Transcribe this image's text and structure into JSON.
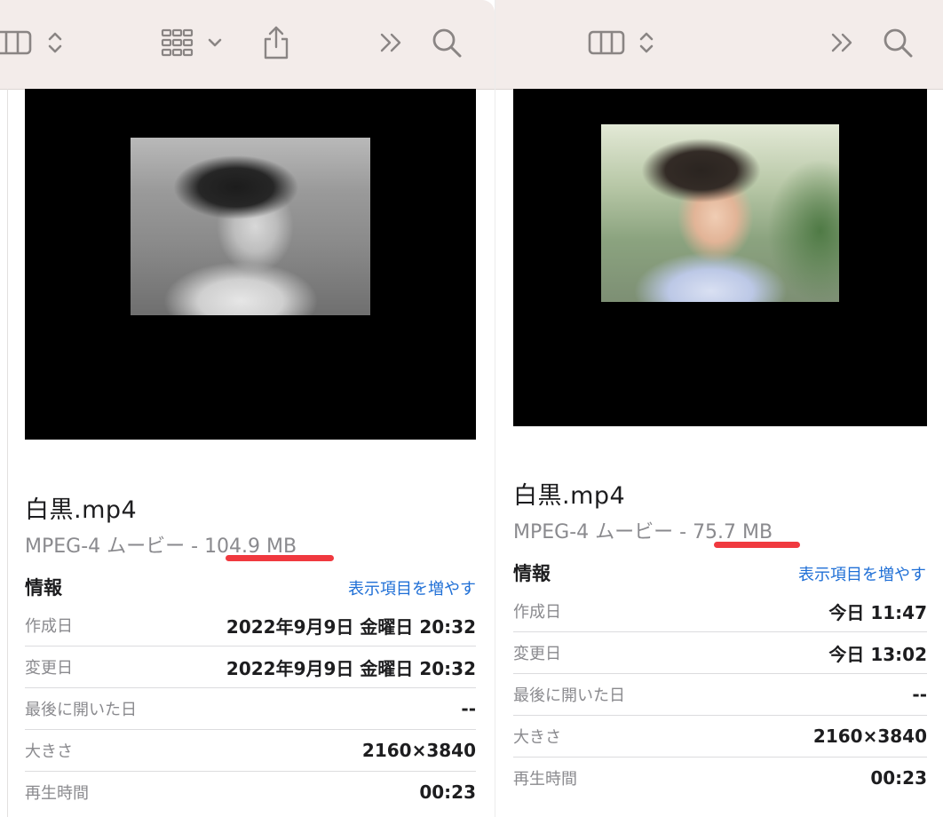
{
  "panes": [
    {
      "toolbar_icons": [
        "column-view-icon",
        "updown-chevron-icon",
        "grid-view-icon",
        "chevron-down-icon",
        "share-icon",
        "more-chevron-icon",
        "search-icon"
      ],
      "filename": "白黒.mp4",
      "kind": "MPEG-4 ムービー - ",
      "size": "104.9 MB",
      "info_heading": "情報",
      "show_more_link": "表示項目を増やす",
      "rows": [
        {
          "label": "作成日",
          "value": "2022年9月9日 金曜日 20:32"
        },
        {
          "label": "変更日",
          "value": "2022年9月9日 金曜日 20:32"
        },
        {
          "label": "最後に開いた日",
          "value": "--"
        },
        {
          "label": "大きさ",
          "value": "2160×3840"
        },
        {
          "label": "再生時間",
          "value": "00:23"
        }
      ],
      "thumbnail": "grayscale-portrait"
    },
    {
      "toolbar_icons": [
        "column-view-icon",
        "updown-chevron-icon",
        "more-chevron-icon",
        "search-icon"
      ],
      "filename": "白黒.mp4",
      "kind": "MPEG-4 ムービー - ",
      "size": "75.7 MB",
      "info_heading": "情報",
      "show_more_link": "表示項目を増やす",
      "rows": [
        {
          "label": "作成日",
          "value": "今日 11:47"
        },
        {
          "label": "変更日",
          "value": "今日 13:02"
        },
        {
          "label": "最後に開いた日",
          "value": "--"
        },
        {
          "label": "大きさ",
          "value": "2160×3840"
        },
        {
          "label": "再生時間",
          "value": "00:23"
        }
      ],
      "thumbnail": "colorized-portrait"
    }
  ],
  "colors": {
    "toolbar_bg": "#f3ecea",
    "link": "#1f6fd6",
    "highlight_underline": "#f0393f",
    "secondary_text": "#8a8a8e"
  }
}
